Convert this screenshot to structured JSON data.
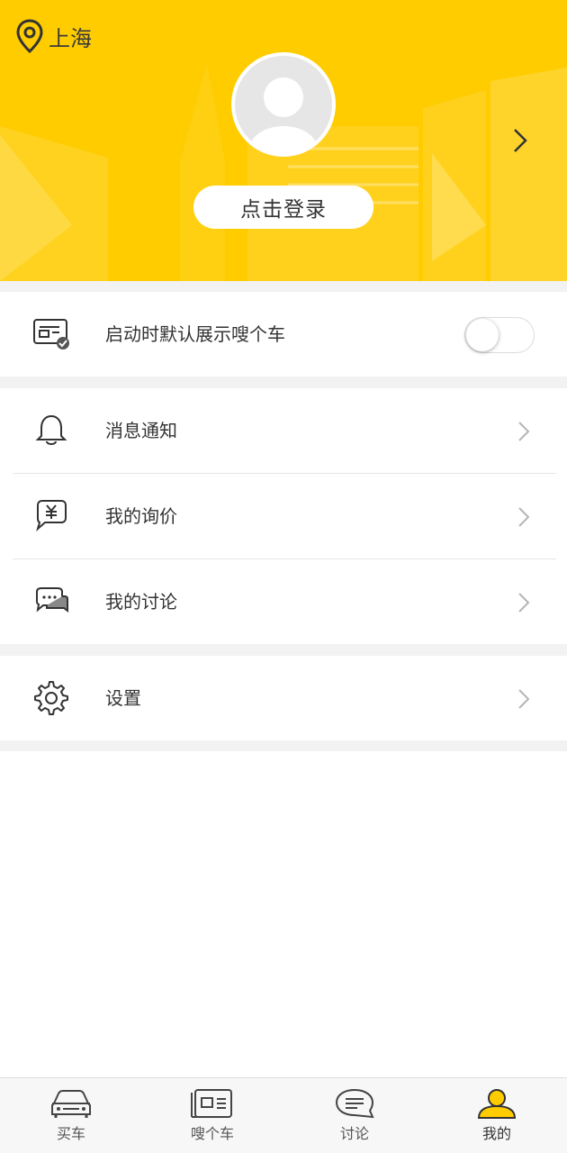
{
  "header": {
    "location": "上海",
    "login_label": "点击登录",
    "accent_color": "#ffcc00"
  },
  "settings": {
    "startup_toggle": {
      "label": "启动时默认展示嗖个车",
      "enabled": false
    }
  },
  "menu": {
    "items": [
      {
        "label": "消息通知",
        "icon": "bell-icon"
      },
      {
        "label": "我的询价",
        "icon": "yuan-chat-icon"
      },
      {
        "label": "我的讨论",
        "icon": "discussion-icon"
      }
    ],
    "settings_item": {
      "label": "设置",
      "icon": "gear-icon"
    }
  },
  "tabbar": {
    "tabs": [
      {
        "label": "买车",
        "icon": "car-icon"
      },
      {
        "label": "嗖个车",
        "icon": "news-icon"
      },
      {
        "label": "讨论",
        "icon": "chat-icon"
      },
      {
        "label": "我的",
        "icon": "user-icon",
        "active": true
      }
    ]
  }
}
